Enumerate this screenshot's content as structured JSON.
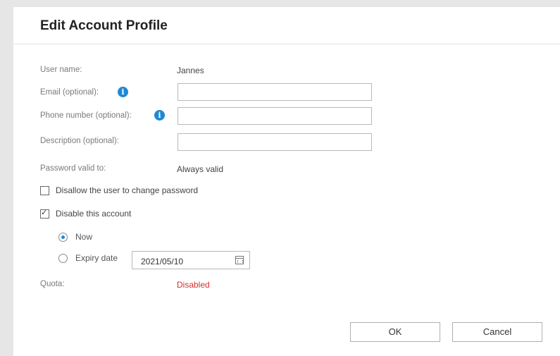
{
  "dialog": {
    "title": "Edit Account Profile"
  },
  "form": {
    "username_label": "User name:",
    "username_value": "Jannes",
    "email_label": "Email (optional):",
    "email_value": "",
    "phone_label": "Phone number (optional):",
    "phone_value": "",
    "description_label": "Description (optional):",
    "description_value": "",
    "password_label": "Password valid to:",
    "password_value": "Always valid",
    "disallow_label": "Disallow the user to change password",
    "disallow_checked": false,
    "disable_label": "Disable this account",
    "disable_checked": true,
    "now_label": "Now",
    "now_selected": true,
    "expiry_label": "Expiry date",
    "expiry_selected": false,
    "expiry_date": "2021/05/10",
    "quota_label": "Quota:",
    "quota_value": "Disabled"
  },
  "buttons": {
    "ok": "OK",
    "cancel": "Cancel"
  },
  "colors": {
    "accent": "#1e88d6",
    "disabled_text": "#d32f2f"
  },
  "icons": {
    "info": "info-icon",
    "calendar": "calendar-icon"
  }
}
